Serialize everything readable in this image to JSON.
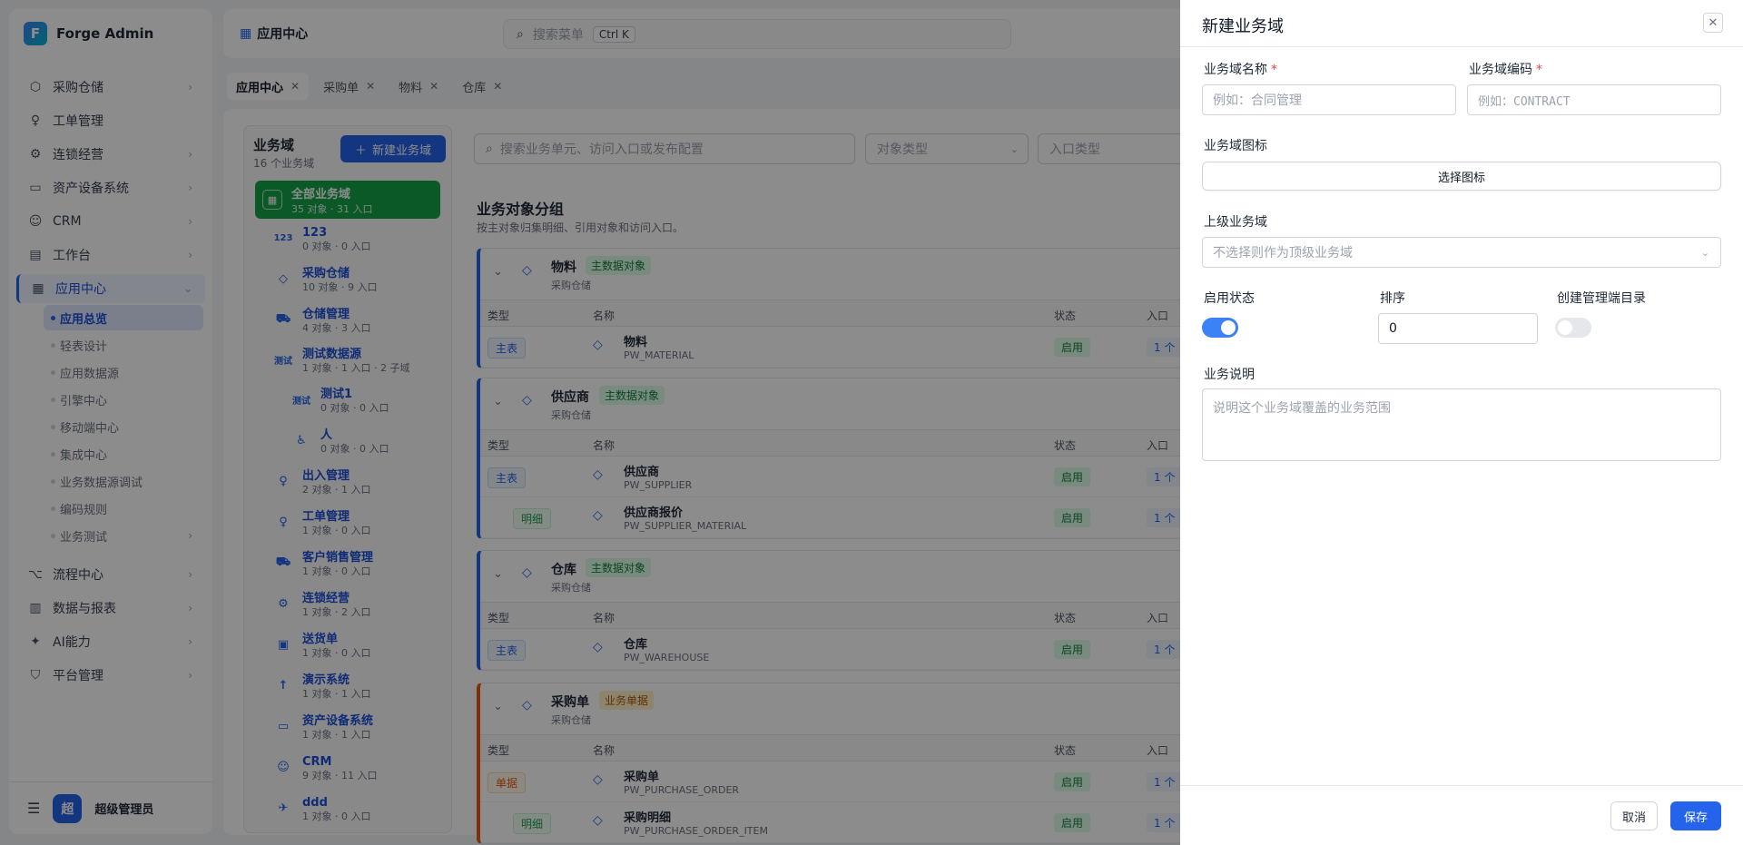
{
  "app": {
    "name": "Forge Admin",
    "logo_letter": "F"
  },
  "sidebar": {
    "items": [
      {
        "label": "采购仓储",
        "icon": "cube-icon"
      },
      {
        "label": "工单管理",
        "icon": "person-icon"
      },
      {
        "label": "连锁经营",
        "icon": "gear-icon"
      },
      {
        "label": "资产设备系统",
        "icon": "monitor-icon"
      },
      {
        "label": "CRM",
        "icon": "users-icon"
      },
      {
        "label": "工作台",
        "icon": "clipboard-icon"
      },
      {
        "label": "应用中心",
        "icon": "app-icon"
      }
    ],
    "sub_items": [
      {
        "label": "应用总览"
      },
      {
        "label": "轻表设计"
      },
      {
        "label": "应用数据源"
      },
      {
        "label": "引擎中心"
      },
      {
        "label": "移动端中心"
      },
      {
        "label": "集成中心"
      },
      {
        "label": "业务数据源调试"
      },
      {
        "label": "编码规则"
      },
      {
        "label": "业务测试"
      }
    ],
    "bottom_items": [
      {
        "label": "流程中心",
        "icon": "flow-icon"
      },
      {
        "label": "数据与报表",
        "icon": "chart-icon"
      },
      {
        "label": "AI能力",
        "icon": "ai-icon"
      },
      {
        "label": "平台管理",
        "icon": "platform-icon"
      }
    ],
    "user": {
      "avatar": "超",
      "name": "超级管理员"
    }
  },
  "header": {
    "title": "应用中心",
    "search_placeholder": "搜索菜单",
    "shortcut": "Ctrl K"
  },
  "tabs": [
    {
      "label": "应用中心"
    },
    {
      "label": "采购单"
    },
    {
      "label": "物料"
    },
    {
      "label": "仓库"
    }
  ],
  "domains": {
    "title": "业务域",
    "count": "16 个业务域",
    "new_button": "新建业务域",
    "all": {
      "name": "全部业务域",
      "meta": "35 对象 · 31 入口"
    },
    "items": [
      {
        "icon": "123",
        "name": "123",
        "meta": "0 对象 · 0 入口"
      },
      {
        "icon": "◇",
        "name": "采购仓储",
        "meta": "10 对象 · 9 入口"
      },
      {
        "icon": "⛟",
        "name": "仓储管理",
        "meta": "4 对象 · 3 入口"
      },
      {
        "icon": "测试",
        "name": "测试数据源",
        "meta": "1 对象 · 1 入口 · 2 子域"
      },
      {
        "icon": "测试",
        "name": "测试1",
        "meta": "0 对象 · 0 入口"
      },
      {
        "icon": "♿",
        "name": "人",
        "meta": "0 对象 · 0 入口"
      },
      {
        "icon": "♀",
        "name": "出入管理",
        "meta": "2 对象 · 1 入口"
      },
      {
        "icon": "♀",
        "name": "工单管理",
        "meta": "1 对象 · 0 入口"
      },
      {
        "icon": "⛟",
        "name": "客户销售管理",
        "meta": "1 对象 · 0 入口"
      },
      {
        "icon": "⚙",
        "name": "连锁经营",
        "meta": "1 对象 · 2 入口"
      },
      {
        "icon": "▣",
        "name": "送货单",
        "meta": "1 对象 · 0 入口"
      },
      {
        "icon": "↑",
        "name": "演示系统",
        "meta": "1 对象 · 1 入口"
      },
      {
        "icon": "▭",
        "name": "资产设备系统",
        "meta": "1 对象 · 1 入口"
      },
      {
        "icon": "☺",
        "name": "CRM",
        "meta": "9 对象 · 11 入口"
      },
      {
        "icon": "✈",
        "name": "ddd",
        "meta": "1 对象 · 0 入口"
      }
    ]
  },
  "filters": {
    "search_placeholder": "搜索业务单元、访问入口或发布配置",
    "type_placeholder": "对象类型",
    "entry_placeholder": "入口类型"
  },
  "group": {
    "title": "业务对象分组",
    "subtitle": "按主对象归集明细、引用对象和访问入口。"
  },
  "table_headers": {
    "type": "类型",
    "name": "名称",
    "status": "状态",
    "entry": "入口"
  },
  "cards": [
    {
      "title": "物料",
      "badge": "主数据对象",
      "sub": "采购仓储",
      "rows": [
        {
          "tag": "主表",
          "name": "物料",
          "code": "PW_MATERIAL",
          "status": "启用",
          "count": "1 个"
        }
      ]
    },
    {
      "title": "供应商",
      "badge": "主数据对象",
      "sub": "采购仓储",
      "rows": [
        {
          "tag": "主表",
          "name": "供应商",
          "code": "PW_SUPPLIER",
          "status": "启用",
          "count": "1 个"
        },
        {
          "tag": "明细",
          "name": "供应商报价",
          "code": "PW_SUPPLIER_MATERIAL",
          "status": "启用",
          "count": "1 个"
        }
      ]
    },
    {
      "title": "仓库",
      "badge": "主数据对象",
      "sub": "采购仓储",
      "rows": [
        {
          "tag": "主表",
          "name": "仓库",
          "code": "PW_WAREHOUSE",
          "status": "启用",
          "count": "1 个"
        }
      ]
    },
    {
      "title": "采购单",
      "badge": "业务单据",
      "sub": "采购仓储",
      "rows": [
        {
          "tag": "单据",
          "name": "采购单",
          "code": "PW_PURCHASE_ORDER",
          "status": "启用",
          "count": "1 个"
        },
        {
          "tag": "明细",
          "name": "采购明细",
          "code": "PW_PURCHASE_ORDER_ITEM",
          "status": "启用",
          "count": "1 个"
        }
      ]
    }
  ],
  "drawer": {
    "title": "新建业务域",
    "name_label": "业务域名称",
    "name_placeholder": "例如：合同管理",
    "code_label": "业务域编码",
    "code_placeholder": "例如：CONTRACT",
    "icon_label": "业务域图标",
    "icon_button": "选择图标",
    "parent_label": "上级业务域",
    "parent_placeholder": "不选择则作为顶级业务域",
    "status_label": "启用状态",
    "status_on": true,
    "sort_label": "排序",
    "sort_value": "0",
    "menu_label": "创建管理端目录",
    "menu_on": false,
    "desc_label": "业务说明",
    "desc_placeholder": "说明这个业务域覆盖的业务范围",
    "cancel": "取消",
    "save": "保存"
  },
  "colors": {
    "primary": "#2563eb",
    "success": "#16a34a",
    "overlay": "rgba(0,0,0,0.45)"
  }
}
